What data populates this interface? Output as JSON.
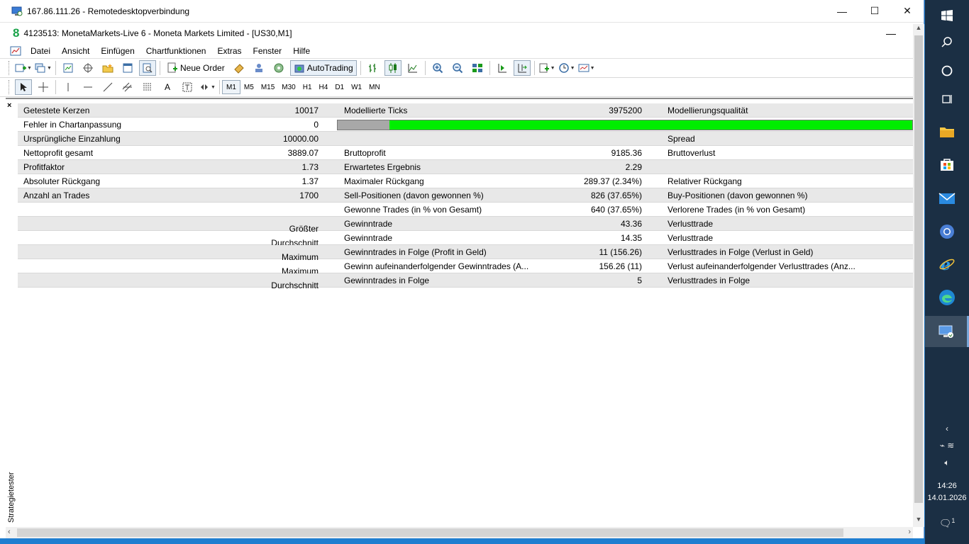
{
  "rdp": {
    "title": "167.86.111.26 - Remotedesktopverbindung",
    "minimize": "—",
    "maximize": "☐",
    "close": "✕"
  },
  "mt4": {
    "title": "4123513: MonetaMarkets-Live 6 - Moneta Markets Limited - [US30,M1]",
    "logo": "8",
    "minimize": "—",
    "menu": [
      "Datei",
      "Ansicht",
      "Einfügen",
      "Chartfunktionen",
      "Extras",
      "Fenster",
      "Hilfe"
    ],
    "toolbar": {
      "new_order": "Neue Order",
      "autotrading": "AutoTrading",
      "timeframes": [
        "M1",
        "M5",
        "M15",
        "M30",
        "H1",
        "H4",
        "D1",
        "W1",
        "MN"
      ],
      "text_tool": "A"
    },
    "panel": {
      "close": "×",
      "vertical_tab": "Strategietester"
    }
  },
  "report": [
    {
      "l_label": "Getestete Kerzen",
      "l_value": "10017",
      "m_label": "Modellierte Ticks",
      "m_value": "3975200",
      "r_label": "Modellierungsqualität",
      "alt": true
    },
    {
      "l_label": "Fehler in Chartanpassung",
      "l_value": "0",
      "quality_bar": true,
      "alt": false
    },
    {
      "l_label": "Ursprüngliche Einzahlung",
      "l_value": "10000.00",
      "m_label": "",
      "m_value": "",
      "r_label": "Spread",
      "alt": true
    },
    {
      "l_label": "Nettoprofit gesamt",
      "l_value": "3889.07",
      "m_label": "Bruttoprofit",
      "m_value": "9185.36",
      "r_label": "Bruttoverlust",
      "alt": false
    },
    {
      "l_label": "Profitfaktor",
      "l_value": "1.73",
      "m_label": "Erwartetes Ergebnis",
      "m_value": "2.29",
      "r_label": "",
      "alt": true
    },
    {
      "l_label": "Absoluter Rückgang",
      "l_value": "1.37",
      "m_label": "Maximaler Rückgang",
      "m_value": "289.37 (2.34%)",
      "r_label": "Relativer Rückgang",
      "alt": false
    },
    {
      "l_label": "Anzahl an Trades",
      "l_value": "1700",
      "m_label": "Sell-Positionen (davon gewonnen %)",
      "m_value": "826 (37.65%)",
      "r_label": "Buy-Positionen (davon gewonnen %)",
      "alt": true
    },
    {
      "l_label": "",
      "l_value": "",
      "m_label": "Gewonne Trades (in % von Gesamt)",
      "m_value": "640 (37.65%)",
      "r_label": "Verlorene Trades (in % von Gesamt)",
      "alt": false
    },
    {
      "l_label": "",
      "l_value": "Größter",
      "m_label": "Gewinntrade",
      "m_value": "43.36",
      "r_label": "Verlusttrade",
      "alt": true
    },
    {
      "l_label": "",
      "l_value": "Durchschnitt",
      "m_label": "Gewinntrade",
      "m_value": "14.35",
      "r_label": "Verlusttrade",
      "alt": false
    },
    {
      "l_label": "",
      "l_value": "Maximum",
      "m_label": "Gewinntrades in Folge (Profit in Geld)",
      "m_value": "11 (156.26)",
      "r_label": "Verlusttrades in Folge (Verlust in Geld)",
      "alt": true
    },
    {
      "l_label": "",
      "l_value": "Maximum",
      "m_label": "Gewinn aufeinanderfolgender Gewinntrades (A...",
      "m_value": "156.26 (11)",
      "r_label": "Verlust aufeinanderfolgender Verlusttrades (Anz...",
      "alt": false
    },
    {
      "l_label": "",
      "l_value": "Durchschnitt",
      "m_label": "Gewinntrades in Folge",
      "m_value": "5",
      "r_label": "Verlusttrades in Folge",
      "alt": true
    }
  ],
  "modelling_quality_fraction": 0.09,
  "colors": {
    "quality_green": "#00ee00",
    "quality_gray": "#a8a8a8",
    "taskbar": "#1b2f44"
  },
  "taskbar": {
    "time": "14:26",
    "date": "14.01.2026",
    "notification_count": "1",
    "icons": [
      "windows-start-icon",
      "search-icon",
      "cortana-icon",
      "task-view-icon",
      "file-explorer-icon",
      "store-icon",
      "mail-icon",
      "chrome-icon",
      "internet-explorer-icon",
      "edge-icon",
      "remote-desktop-icon"
    ]
  }
}
